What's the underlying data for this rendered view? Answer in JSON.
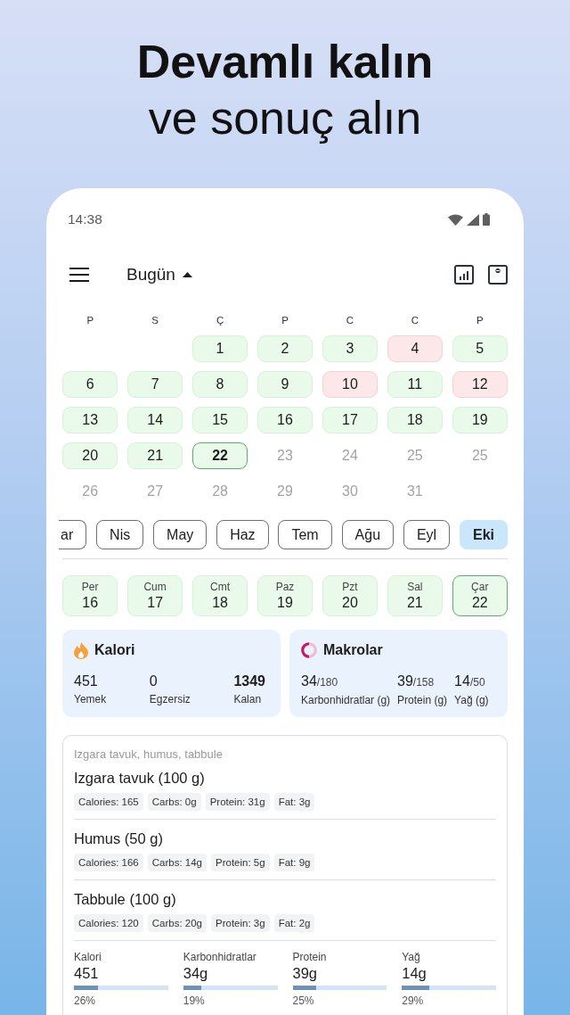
{
  "headline": {
    "title": "Devamlı kalın",
    "subtitle": "ve sonuç alın"
  },
  "status_bar": {
    "time": "14:38"
  },
  "toolbar": {
    "title": "Bugün"
  },
  "calendar": {
    "weekdays": [
      "P",
      "S",
      "Ç",
      "P",
      "C",
      "C",
      "P"
    ],
    "weeks": [
      {
        "days": [
          {
            "day": "1",
            "kind": "goal",
            "selected": false
          },
          {
            "day": "2",
            "kind": "goal",
            "selected": false
          },
          {
            "day": "3",
            "kind": "goal",
            "selected": false
          },
          {
            "day": "4",
            "kind": "over",
            "selected": false
          },
          {
            "day": "5",
            "kind": "goal",
            "selected": false
          }
        ]
      },
      {
        "days": [
          {
            "day": "6",
            "kind": "goal",
            "selected": false
          },
          {
            "day": "7",
            "kind": "goal",
            "selected": false
          },
          {
            "day": "8",
            "kind": "goal",
            "selected": false
          },
          {
            "day": "9",
            "kind": "goal",
            "selected": false
          },
          {
            "day": "10",
            "kind": "over",
            "selected": false
          },
          {
            "day": "11",
            "kind": "goal",
            "selected": false
          },
          {
            "day": "12",
            "kind": "over",
            "selected": false
          }
        ]
      },
      {
        "days": [
          {
            "day": "13",
            "kind": "goal",
            "selected": false
          },
          {
            "day": "14",
            "kind": "goal",
            "selected": false
          },
          {
            "day": "15",
            "kind": "goal",
            "selected": false
          },
          {
            "day": "16",
            "kind": "goal",
            "selected": false
          },
          {
            "day": "17",
            "kind": "goal",
            "selected": false
          },
          {
            "day": "18",
            "kind": "goal",
            "selected": false
          },
          {
            "day": "19",
            "kind": "goal",
            "selected": false
          }
        ]
      },
      {
        "days": [
          {
            "day": "20",
            "kind": "goal",
            "selected": false
          },
          {
            "day": "21",
            "kind": "goal",
            "selected": false
          },
          {
            "day": "22",
            "kind": "goal",
            "selected": true
          },
          {
            "day": "23",
            "kind": "future",
            "selected": false
          },
          {
            "day": "24",
            "kind": "future",
            "selected": false
          },
          {
            "day": "25",
            "kind": "future",
            "selected": false
          },
          {
            "day": "25",
            "kind": "future",
            "selected": false
          }
        ]
      },
      {
        "days": [
          {
            "day": "26",
            "kind": "future",
            "selected": false
          },
          {
            "day": "27",
            "kind": "future",
            "selected": false
          },
          {
            "day": "28",
            "kind": "future",
            "selected": false
          },
          {
            "day": "29",
            "kind": "future",
            "selected": false
          },
          {
            "day": "30",
            "kind": "future",
            "selected": false
          },
          {
            "day": "31",
            "kind": "future",
            "selected": false
          }
        ]
      }
    ]
  },
  "months": [
    {
      "label": "ar",
      "selected": false
    },
    {
      "label": "Nis",
      "selected": false
    },
    {
      "label": "May",
      "selected": false
    },
    {
      "label": "Haz",
      "selected": false
    },
    {
      "label": "Tem",
      "selected": false
    },
    {
      "label": "Ağu",
      "selected": false
    },
    {
      "label": "Eyl",
      "selected": false
    },
    {
      "label": "Eki",
      "selected": true
    }
  ],
  "week_strip": [
    {
      "weekday": "Per",
      "day": "16",
      "selected": false
    },
    {
      "weekday": "Cum",
      "day": "17",
      "selected": false
    },
    {
      "weekday": "Cmt",
      "day": "18",
      "selected": false
    },
    {
      "weekday": "Paz",
      "day": "19",
      "selected": false
    },
    {
      "weekday": "Pzt",
      "day": "20",
      "selected": false
    },
    {
      "weekday": "Sal",
      "day": "21",
      "selected": false
    },
    {
      "weekday": "Çar",
      "day": "22",
      "selected": true
    }
  ],
  "calories": {
    "title": "Kalori",
    "stats": [
      {
        "value": "451",
        "label": "Yemek",
        "emphasized": false
      },
      {
        "value": "0",
        "label": "Egzersiz",
        "emphasized": false
      },
      {
        "value": "1349",
        "label": "Kalan",
        "emphasized": true
      }
    ]
  },
  "macros": {
    "title": "Makrolar",
    "stats": [
      {
        "value": "34",
        "goal": "/180",
        "label": "Karbonhidratlar (g)"
      },
      {
        "value": "39",
        "goal": "/158",
        "label": "Protein (g)"
      },
      {
        "value": "14",
        "goal": "/50",
        "label": "Yağ (g)"
      }
    ]
  },
  "meal": {
    "summary": "Izgara tavuk, humus, tabbule",
    "foods": [
      {
        "name": "Izgara tavuk (100 g)",
        "tags": [
          "Calories: 165",
          "Carbs: 0g",
          "Protein: 31g",
          "Fat: 3g"
        ]
      },
      {
        "name": "Humus (50 g)",
        "tags": [
          "Calories: 166",
          "Carbs: 14g",
          "Protein: 5g",
          "Fat: 9g"
        ]
      },
      {
        "name": "Tabbule (100 g)",
        "tags": [
          "Calories: 120",
          "Carbs: 20g",
          "Protein: 3g",
          "Fat: 2g"
        ]
      }
    ],
    "totals": [
      {
        "label": "Kalori",
        "value": "451",
        "level": 0.26,
        "percent": "26%"
      },
      {
        "label": "Karbonhidratlar",
        "value": "34g",
        "level": 0.19,
        "percent": "19%"
      },
      {
        "label": "Protein",
        "value": "39g",
        "level": 0.25,
        "percent": "25%"
      },
      {
        "label": "Yağ",
        "value": "14g",
        "level": 0.29,
        "percent": "29%"
      }
    ]
  }
}
